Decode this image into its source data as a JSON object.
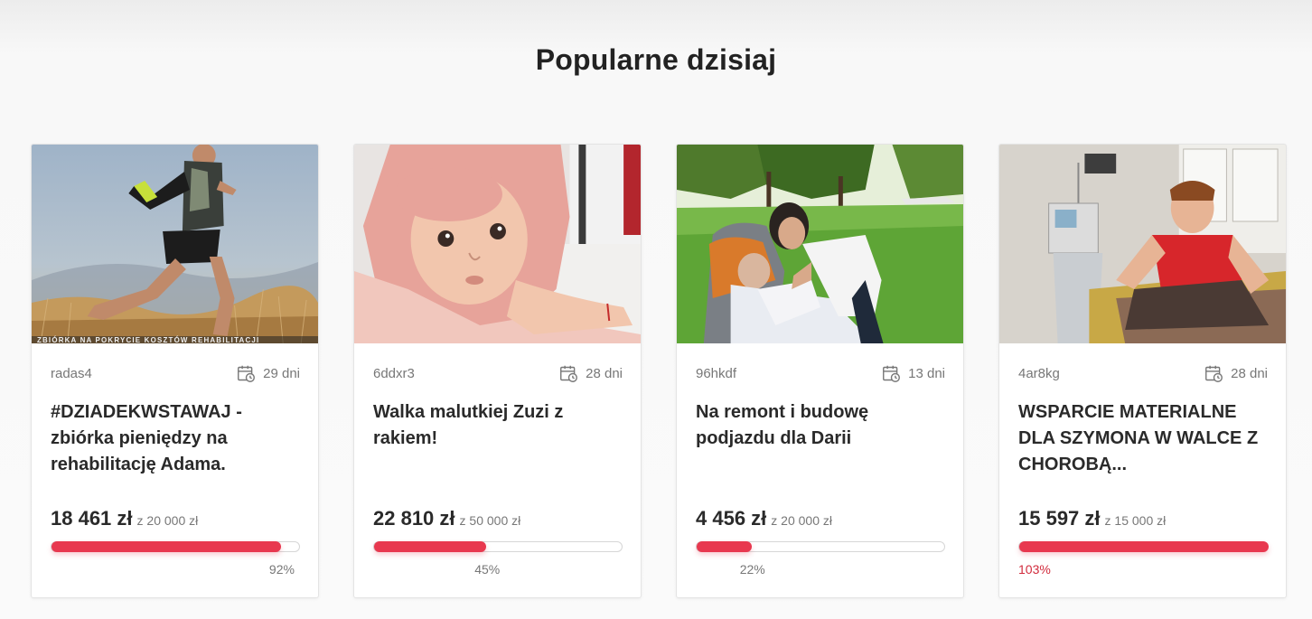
{
  "section": {
    "title": "Popularne dzisiaj"
  },
  "cards": [
    {
      "image": "runner-photo",
      "image_caption": "ZBIÓRKA NA POKRYCIE KOSZTÓW REHABILITACJI",
      "author": "radas4",
      "days": "29 dni",
      "title": "#DZIADEKWSTAWAJ - zbiórka pieniędzy na rehabilitację Adama.",
      "raised": "18 461 zł",
      "goal": "z 20 000 zł",
      "percent_label": "92%",
      "progress": 0.92
    },
    {
      "image": "baby-in-towel-photo",
      "author": "6ddxr3",
      "days": "28 dni",
      "title": "Walka malutkiej Zuzi z rakiem!",
      "raised": "22 810 zł",
      "goal": "z 50 000 zł",
      "percent_label": "45%",
      "progress": 0.45
    },
    {
      "image": "park-wheelchair-photo",
      "author": "96hkdf",
      "days": "13 dni",
      "title": "Na remont i budowę podjazdu dla Darii",
      "raised": "4 456 zł",
      "goal": "z 20 000 zł",
      "percent_label": "22%",
      "progress": 0.22
    },
    {
      "image": "hospital-boy-photo",
      "author": "4ar8kg",
      "days": "28 dni",
      "title": "WSPARCIE MATERIALNE DLA SZYMONA W WALCE Z CHOROBĄ...",
      "raised": "15 597 zł",
      "goal": "z 15 000 zł",
      "percent_label": "103%",
      "progress": 1.0
    }
  ],
  "colors": {
    "accent": "#e8384f",
    "over_goal_text": "#d12b3c",
    "muted_text": "#777777"
  },
  "icons": {
    "days": "calendar-clock-icon"
  }
}
